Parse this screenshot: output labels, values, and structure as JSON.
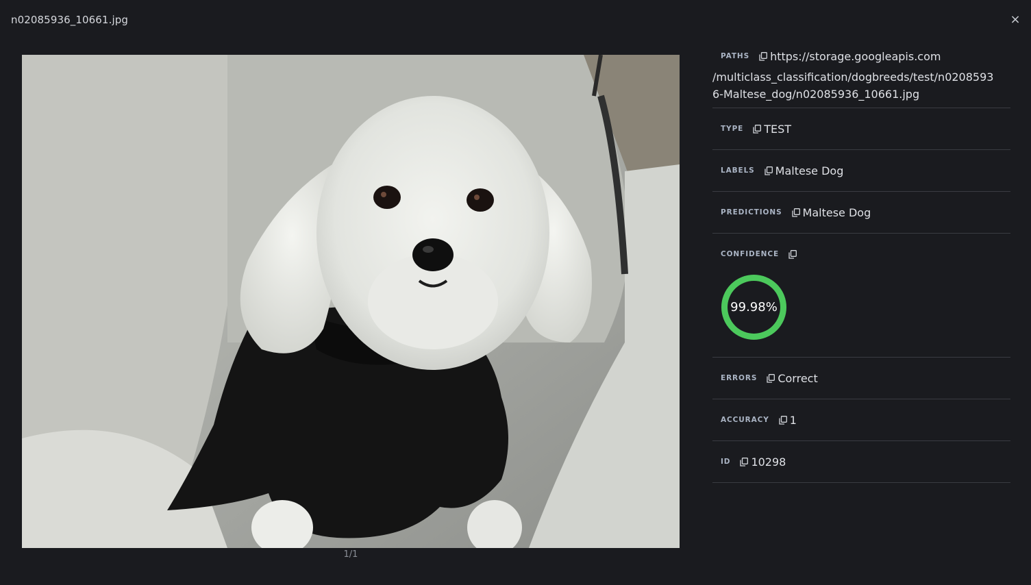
{
  "window": {
    "title": "n02085936_10661.jpg",
    "close_label": "×"
  },
  "viewer": {
    "pager": "1/1",
    "image_alt": "White Maltese dog wearing a black sweater sitting on a white pillow"
  },
  "fields": {
    "paths": {
      "key": "paths",
      "value_first": "https://storage.googleapis.com",
      "value_rest": "/multiclass_classification/dogbreeds/test/n02085936-Maltese_dog/n02085936_10661.jpg"
    },
    "type": {
      "key": "type",
      "value": "TEST"
    },
    "labels": {
      "key": "labels",
      "value": "Maltese Dog"
    },
    "predictions": {
      "key": "predictions",
      "value": "Maltese Dog"
    },
    "confidence": {
      "key": "confidence",
      "value": "99.98%",
      "fraction": 0.9998
    },
    "errors": {
      "key": "errors",
      "value": "Correct"
    },
    "accuracy": {
      "key": "accuracy",
      "value": "1"
    },
    "id": {
      "key": "id",
      "value": "10298"
    }
  },
  "colors": {
    "background": "#1a1b1f",
    "divider": "#3a3c42",
    "confidence_ring": "#4cc95c"
  },
  "icons": {
    "copy": "copy-icon",
    "close": "close-icon"
  }
}
